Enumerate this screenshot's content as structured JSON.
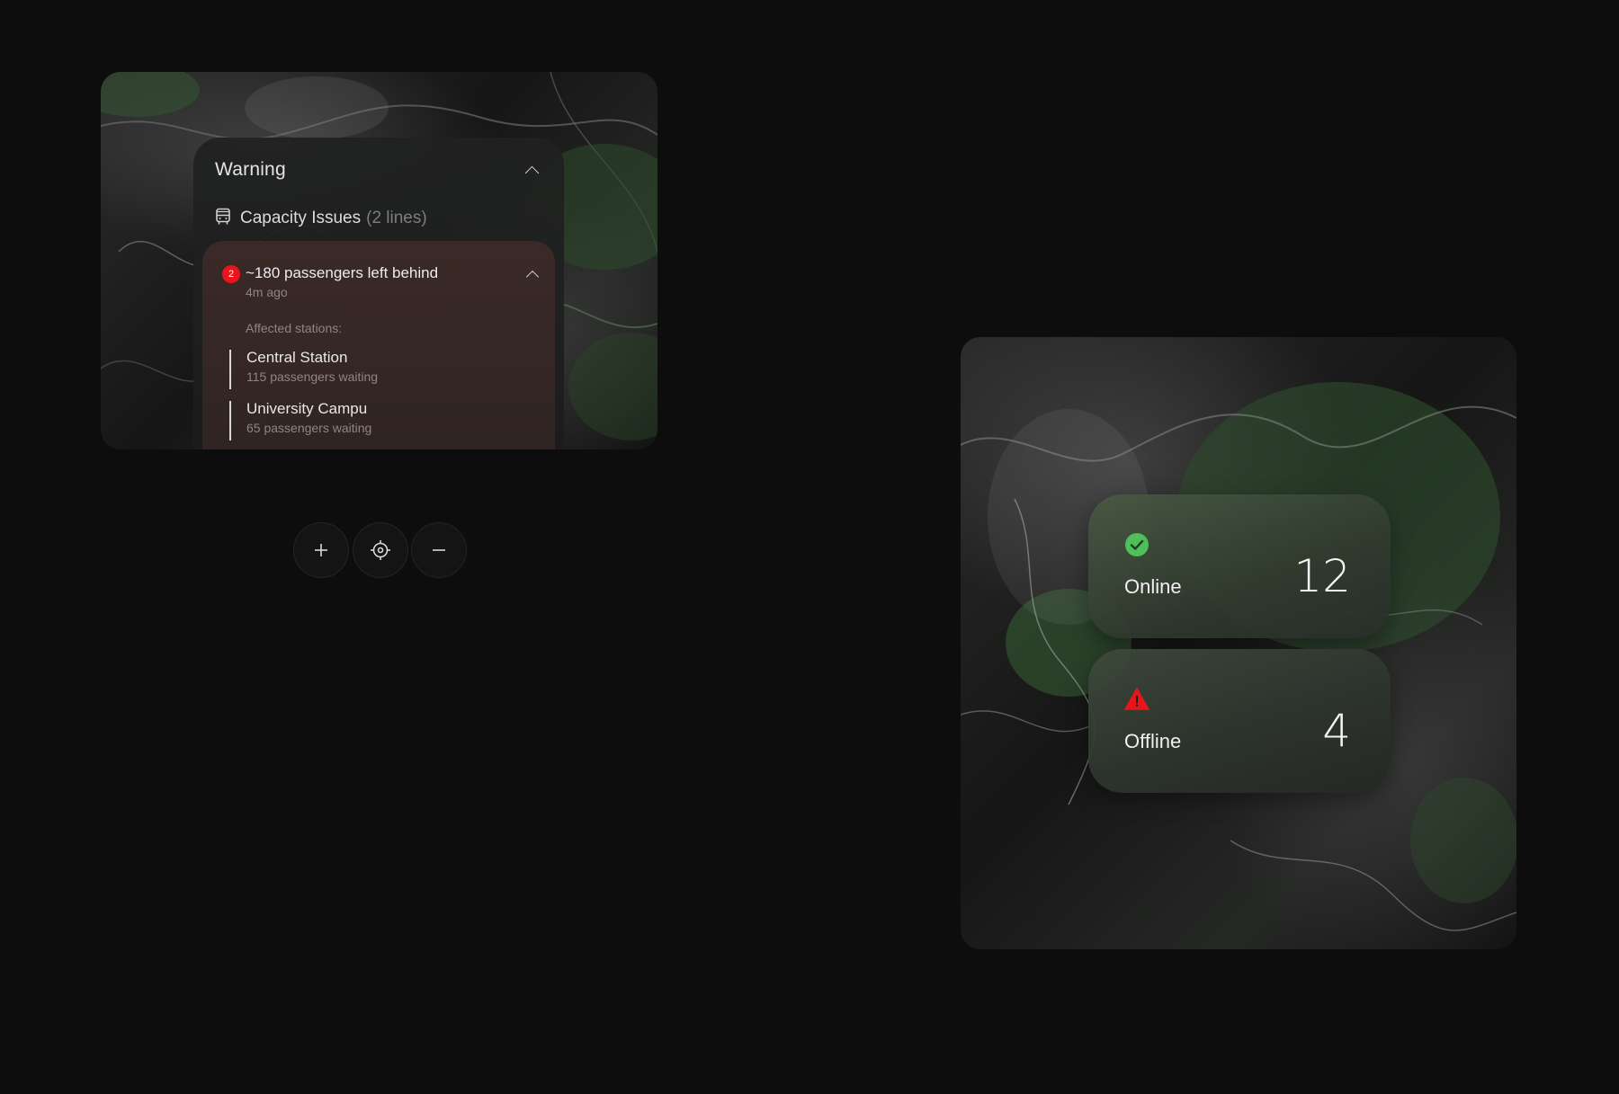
{
  "warning_panel": {
    "title": "Warning",
    "category": {
      "icon": "bus-icon",
      "label": "Capacity Issues",
      "count_text": "(2 lines)"
    },
    "issue": {
      "badge": "2",
      "title": "~180 passengers left behind",
      "time": "4m ago",
      "affected_label": "Affected stations:",
      "stations": [
        {
          "name": "Central Station",
          "waiting": "115 passengers waiting"
        },
        {
          "name": "University Campu",
          "waiting": "65 passengers waiting"
        }
      ]
    }
  },
  "map_controls": {
    "zoom_in_icon": "plus-icon",
    "locate_icon": "crosshair-icon",
    "zoom_out_icon": "minus-icon"
  },
  "status": {
    "online": {
      "label": "Online",
      "value": "12",
      "icon": "check-circle-icon",
      "color": "#4fbf5a"
    },
    "offline": {
      "label": "Offline",
      "value": "4",
      "icon": "warning-triangle-icon",
      "color": "#e8151b"
    }
  },
  "colors": {
    "background": "#0d0d0d",
    "alert_red": "#e8151b"
  }
}
